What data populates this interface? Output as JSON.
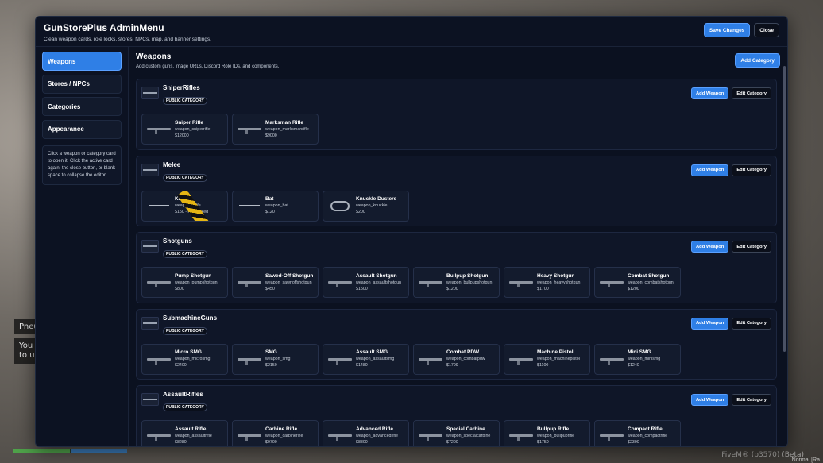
{
  "background": {
    "hint_title": "Pneu",
    "hint_text": "You c\nto us",
    "fivem": "FiveM® (b3570) (Beta)",
    "fivem_sub": "Normal [Ra"
  },
  "header": {
    "title": "GunStorePlus AdminMenu",
    "subtitle": "Clean weapon cards, role locks, stores, NPCs, map, and banner settings.",
    "save_label": "Save Changes",
    "close_label": "Close"
  },
  "sidebar": {
    "items": [
      {
        "label": "Weapons",
        "active": true
      },
      {
        "label": "Stores / NPCs",
        "active": false
      },
      {
        "label": "Categories",
        "active": false
      },
      {
        "label": "Appearance",
        "active": false
      }
    ],
    "note": "Click a weapon or category card to open it. Click the active card again, the close button, or blank space to collapse the editor."
  },
  "main": {
    "title": "Weapons",
    "subtitle": "Add custom guns, image URLs, Discord Role IDs, and components.",
    "add_category_label": "Add Category",
    "add_weapon_label": "Add Weapon",
    "edit_category_label": "Edit Category",
    "badge_label": "PUBLIC CATEGORY",
    "categories": [
      {
        "name": "SniperRifles",
        "weapons": [
          {
            "name": "Sniper Rifle",
            "id": "weapon_sniperrifle",
            "price": "$12000",
            "icon": "rifle-icon"
          },
          {
            "name": "Marksman Rifle",
            "id": "weapon_marksmanrifle",
            "price": "$9000",
            "icon": "rifle-icon"
          }
        ]
      },
      {
        "name": "Melee",
        "weapons": [
          {
            "name": "Knife",
            "id": "weapon_knife",
            "price": "$150 - role locked",
            "icon": "knife-icon",
            "locked": true
          },
          {
            "name": "Bat",
            "id": "weapon_bat",
            "price": "$120",
            "icon": "knife-icon"
          },
          {
            "name": "Knuckle Dusters",
            "id": "weapon_knuckle",
            "price": "$200",
            "icon": "knuckle-icon"
          }
        ]
      },
      {
        "name": "Shotguns",
        "weapons": [
          {
            "name": "Pump Shotgun",
            "id": "weapon_pumpshotgun",
            "price": "$800",
            "icon": "rifle-icon"
          },
          {
            "name": "Sawed-Off Shotgun",
            "id": "weapon_sawnoffshotgun",
            "price": "$450",
            "icon": "rifle-icon"
          },
          {
            "name": "Assault Shotgun",
            "id": "weapon_assaultshotgun",
            "price": "$1500",
            "icon": "rifle-icon"
          },
          {
            "name": "Bullpup Shotgun",
            "id": "weapon_bullpupshotgun",
            "price": "$1200",
            "icon": "rifle-icon"
          },
          {
            "name": "Heavy Shotgun",
            "id": "weapon_heavyshotgun",
            "price": "$1700",
            "icon": "rifle-icon"
          },
          {
            "name": "Combat Shotgun",
            "id": "weapon_combatshotgun",
            "price": "$1200",
            "icon": "rifle-icon"
          }
        ]
      },
      {
        "name": "SubmachineGuns",
        "weapons": [
          {
            "name": "Micro SMG",
            "id": "weapon_microsmg",
            "price": "$2400",
            "icon": "rifle-icon"
          },
          {
            "name": "SMG",
            "id": "weapon_smg",
            "price": "$2150",
            "icon": "rifle-icon"
          },
          {
            "name": "Assault SMG",
            "id": "weapon_assaultsmg",
            "price": "$1480",
            "icon": "rifle-icon"
          },
          {
            "name": "Combat PDW",
            "id": "weapon_combatpdw",
            "price": "$1799",
            "icon": "rifle-icon"
          },
          {
            "name": "Machine Pistol",
            "id": "weapon_machinepistol",
            "price": "$1100",
            "icon": "rifle-icon"
          },
          {
            "name": "Mini SMG",
            "id": "weapon_minismg",
            "price": "$1240",
            "icon": "rifle-icon"
          }
        ]
      },
      {
        "name": "AssaultRifles",
        "weapons": [
          {
            "name": "Assault Rifle",
            "id": "weapon_assaultrifle",
            "price": "$8280",
            "icon": "rifle-icon"
          },
          {
            "name": "Carbine Rifle",
            "id": "weapon_carbinerifle",
            "price": "$9700",
            "icon": "rifle-icon"
          },
          {
            "name": "Advanced Rifle",
            "id": "weapon_advancedrifle",
            "price": "$8800",
            "icon": "rifle-icon"
          },
          {
            "name": "Special Carbine",
            "id": "weapon_specialcarbine",
            "price": "$7200",
            "icon": "rifle-icon"
          },
          {
            "name": "Bullpup Rifle",
            "id": "weapon_bullpuprifle",
            "price": "$1750",
            "icon": "rifle-icon"
          },
          {
            "name": "Compact Rifle",
            "id": "weapon_compactrifle",
            "price": "$2390",
            "icon": "rifle-icon"
          }
        ]
      }
    ]
  },
  "colors": {
    "accent": "#2f7fe6",
    "panel": "#0c1222",
    "card": "#131b2d"
  }
}
